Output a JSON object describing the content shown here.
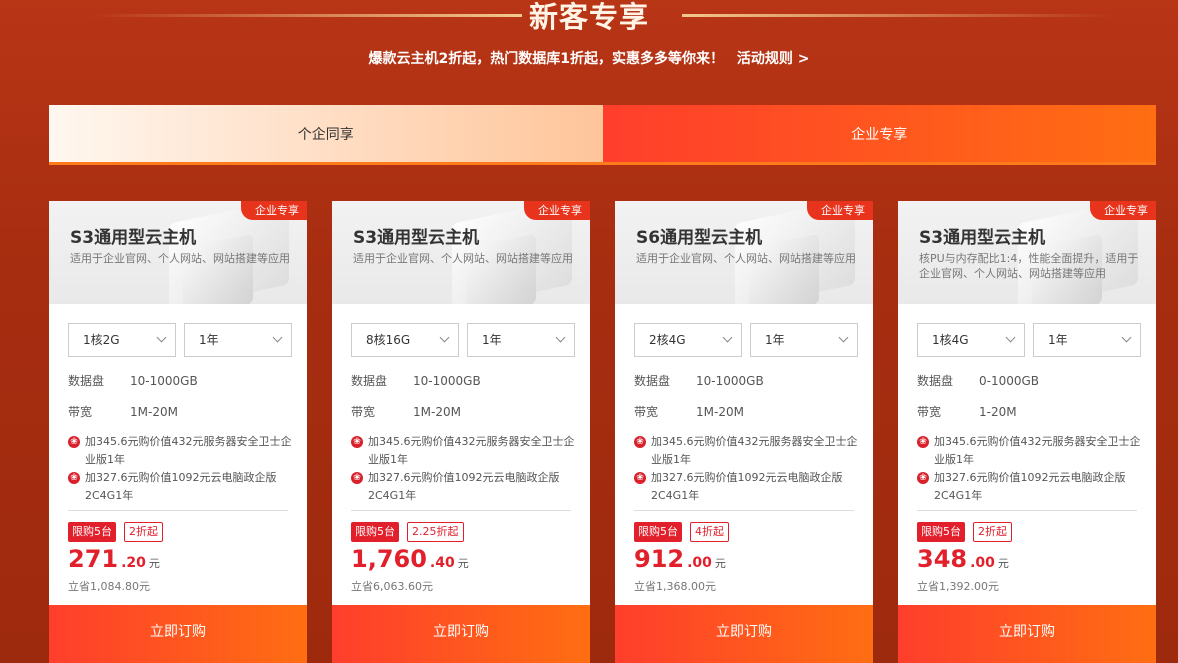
{
  "header": {
    "title": "新客专享",
    "subtitle": "爆款云主机2折起，热门数据库1折起，实惠多多等你来！",
    "rules_link": "活动规则 >"
  },
  "tabs": [
    {
      "label": "个企同享",
      "active": false
    },
    {
      "label": "企业专享",
      "active": true
    }
  ],
  "colors": {
    "accent": "#e2202c",
    "orange": "#ff6e12",
    "background": "#a72d10"
  },
  "cards": [
    {
      "badge": "企业专享",
      "title": "S3通用型云主机",
      "desc": "适用于企业官网、个人网站、网站搭建等应用",
      "config": "1核2G",
      "period": "1年",
      "disk_label": "数据盘",
      "disk": "10-1000GB",
      "bw_label": "带宽",
      "bw": "1M-20M",
      "gift1": "加345.6元购价值432元服务器安全卫士企业版1年",
      "gift2": "加327.6元购价值1092元云电脑政企版2C4G1年",
      "limit": "限购5台",
      "discount": "2折起",
      "price_int": "271",
      "price_dec": ".20",
      "unit": "元",
      "saved": "立省1,084.80元",
      "buy": "立即订购"
    },
    {
      "badge": "企业专享",
      "title": "S3通用型云主机",
      "desc": "适用于企业官网、个人网站、网站搭建等应用",
      "config": "8核16G",
      "period": "1年",
      "disk_label": "数据盘",
      "disk": "10-1000GB",
      "bw_label": "带宽",
      "bw": "1M-20M",
      "gift1": "加345.6元购价值432元服务器安全卫士企业版1年",
      "gift2": "加327.6元购价值1092元云电脑政企版2C4G1年",
      "limit": "限购5台",
      "discount": "2.25折起",
      "price_int": "1,760",
      "price_dec": ".40",
      "unit": "元",
      "saved": "立省6,063.60元",
      "buy": "立即订购"
    },
    {
      "badge": "企业专享",
      "title": "S6通用型云主机",
      "desc": "适用于企业官网、个人网站、网站搭建等应用",
      "config": "2核4G",
      "period": "1年",
      "disk_label": "数据盘",
      "disk": "10-1000GB",
      "bw_label": "带宽",
      "bw": "1M-20M",
      "gift1": "加345.6元购价值432元服务器安全卫士企业版1年",
      "gift2": "加327.6元购价值1092元云电脑政企版2C4G1年",
      "limit": "限购5台",
      "discount": "4折起",
      "price_int": "912",
      "price_dec": ".00",
      "unit": "元",
      "saved": "立省1,368.00元",
      "buy": "立即订购"
    },
    {
      "badge": "企业专享",
      "title": "S3通用型云主机",
      "desc": "核PU与内存配比1:4，性能全面提升，适用于企业官网、个人网站、网站搭建等应用",
      "config": "1核4G",
      "period": "1年",
      "disk_label": "数据盘",
      "disk": "0-1000GB",
      "bw_label": "带宽",
      "bw": "1-20M",
      "gift1": "加345.6元购价值432元服务器安全卫士企业版1年",
      "gift2": "加327.6元购价值1092元云电脑政企版2C4G1年",
      "limit": "限购5台",
      "discount": "2折起",
      "price_int": "348",
      "price_dec": ".00",
      "unit": "元",
      "saved": "立省1,392.00元",
      "buy": "立即订购"
    }
  ]
}
